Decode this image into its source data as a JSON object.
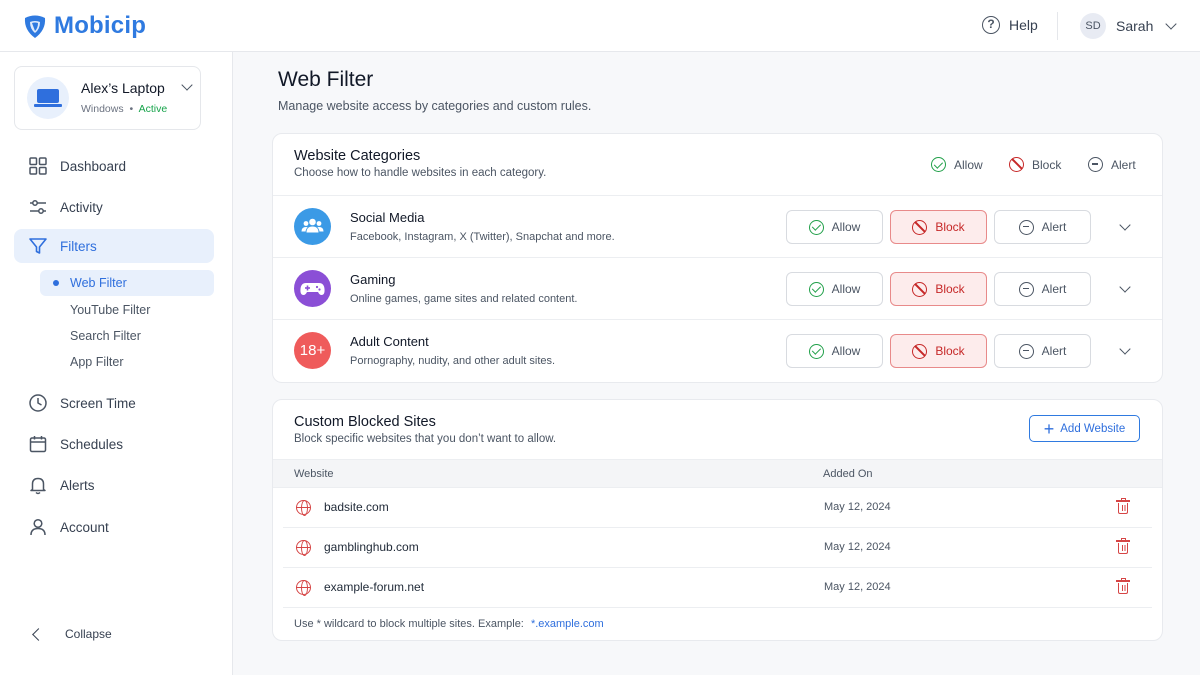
{
  "brand": {
    "name": "Mobicip",
    "color": "#2f7ae0"
  },
  "header": {
    "help_label": "Help",
    "user_initials": "SD",
    "user_name": "Sarah"
  },
  "device": {
    "name": "Alex’s Laptop",
    "os": "Windows",
    "separator": "•",
    "status": "Active"
  },
  "nav": {
    "items": [
      {
        "label": "Dashboard",
        "icon": "grid-icon"
      },
      {
        "label": "Activity",
        "icon": "sliders-icon"
      },
      {
        "label": "Filters",
        "icon": "funnel-icon",
        "active": true
      },
      {
        "label": "Screen Time",
        "icon": "clock-icon"
      },
      {
        "label": "Schedules",
        "icon": "calendar-icon"
      },
      {
        "label": "Alerts",
        "icon": "bell-icon"
      },
      {
        "label": "Account",
        "icon": "user-icon"
      }
    ],
    "sub_items": [
      {
        "label": "Web Filter",
        "active": true
      },
      {
        "label": "YouTube Filter"
      },
      {
        "label": "Search Filter"
      },
      {
        "label": "App Filter"
      }
    ],
    "collapse_label": "Collapse"
  },
  "page": {
    "title": "Web Filter",
    "subtitle": "Manage website access by categories and custom rules."
  },
  "categories": {
    "title": "Website Categories",
    "subtitle": "Choose how to handle websites in each category.",
    "legend": {
      "allow": "Allow",
      "block": "Block",
      "alert": "Alert"
    },
    "rows": [
      {
        "name": "Social Media",
        "description": "Facebook, Instagram, X (Twitter), Snapchat and more.",
        "icon": "people-icon",
        "icon_color": "#3b9ae6",
        "selected": "Block"
      },
      {
        "name": "Gaming",
        "description": "Online games, game sites and related content.",
        "icon": "gamepad-icon",
        "icon_color": "#8b4fd6",
        "selected": "Block"
      },
      {
        "name": "Adult Content",
        "description": "Pornography, nudity, and other adult sites.",
        "icon": "18-plus-icon",
        "icon_text": "18+",
        "icon_color": "#ef5b5b",
        "selected": "Block"
      }
    ],
    "button_labels": {
      "allow": "Allow",
      "block": "Block",
      "alert": "Alert"
    }
  },
  "custom_sites": {
    "title": "Custom Blocked Sites",
    "subtitle": "Block specific websites that you don’t want to allow.",
    "add_label": "Add Website",
    "columns": {
      "website": "Website",
      "added_on": "Added On"
    },
    "rows": [
      {
        "site": "badsite.com",
        "added_on": "May 12, 2024"
      },
      {
        "site": "gamblinghub.com",
        "added_on": "May 12, 2024"
      },
      {
        "site": "example-forum.net",
        "added_on": "May 12, 2024"
      }
    ],
    "note": "Use * wildcard to block multiple sites. Example:",
    "note_example": "*.example.com"
  }
}
